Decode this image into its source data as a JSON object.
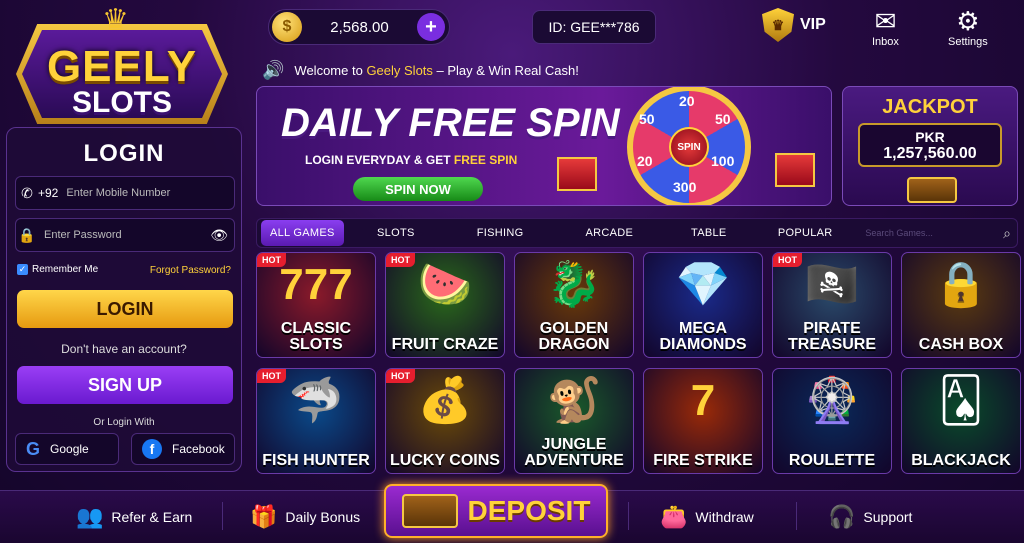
{
  "logo": {
    "line1": "GEELY",
    "line2": "SLOTS"
  },
  "topbar": {
    "balance": "2,568.00",
    "user_id": "ID: GEE***786",
    "vip_label": "VIP",
    "inbox_label": "Inbox",
    "settings_label": "Settings"
  },
  "marquee": {
    "prefix": "Welcome to ",
    "brand": "Geely Slots",
    "suffix": " – Play & Win Real Cash!"
  },
  "login": {
    "title": "LOGIN",
    "country_code": "+92",
    "mobile_placeholder": "Enter Mobile Number",
    "password_placeholder": "Enter Password",
    "remember_label": "Remember Me",
    "forgot_label": "Forgot Password?",
    "login_button": "LOGIN",
    "no_account": "Don't have an account?",
    "signup_button": "SIGN UP",
    "or_login_with": "Or Login With",
    "google_label": "Google",
    "facebook_label": "Facebook"
  },
  "banner": {
    "title": "DAILY FREE SPIN",
    "subtitle_prefix": "LOGIN EVERYDAY & GET ",
    "subtitle_highlight": "FREE SPIN",
    "button": "SPIN NOW",
    "wheel_center": "SPIN",
    "wheel_numbers": [
      "20",
      "50",
      "100",
      "300",
      "20",
      "50"
    ]
  },
  "jackpot": {
    "title": "JACKPOT",
    "currency": "PKR",
    "value": "1,257,560.00"
  },
  "tabs": [
    {
      "label": "ALL GAMES",
      "active": true
    },
    {
      "label": "SLOTS",
      "active": false
    },
    {
      "label": "FISHING",
      "active": false
    },
    {
      "label": "ARCADE",
      "active": false
    },
    {
      "label": "TABLE",
      "active": false
    },
    {
      "label": "POPULAR",
      "active": false
    }
  ],
  "search": {
    "placeholder": "Search Games..."
  },
  "games": [
    {
      "name": "CLASSIC SLOTS",
      "hot": true,
      "icon": "777",
      "bg": "#8a1a2a"
    },
    {
      "name": "FRUIT CRAZE",
      "hot": true,
      "icon": "🍉",
      "bg": "#2a6a1a"
    },
    {
      "name": "GOLDEN DRAGON",
      "hot": false,
      "icon": "🐉",
      "bg": "#6a3a08"
    },
    {
      "name": "MEGA DIAMONDS",
      "hot": false,
      "icon": "💎",
      "bg": "#1a2a8a"
    },
    {
      "name": "PIRATE TREASURE",
      "hot": true,
      "icon": "🏴‍☠️",
      "bg": "#2a4a6a"
    },
    {
      "name": "CASH BOX",
      "hot": false,
      "icon": "🔒",
      "bg": "#5a3a10"
    },
    {
      "name": "FISH HUNTER",
      "hot": true,
      "icon": "🦈",
      "bg": "#0a4a8a"
    },
    {
      "name": "LUCKY COINS",
      "hot": true,
      "icon": "💰",
      "bg": "#6a4a08"
    },
    {
      "name": "JUNGLE ADVENTURE",
      "hot": false,
      "icon": "🐒",
      "bg": "#1a5a2a"
    },
    {
      "name": "FIRE STRIKE",
      "hot": false,
      "icon": "7",
      "bg": "#9a2a08"
    },
    {
      "name": "ROULETTE",
      "hot": false,
      "icon": "🎡",
      "bg": "#0a2a5a"
    },
    {
      "name": "BLACKJACK",
      "hot": false,
      "icon": "🂡",
      "bg": "#0a4a2a"
    }
  ],
  "bottom": {
    "refer": "Refer & Earn",
    "daily_bonus": "Daily Bonus",
    "deposit": "DEPOSIT",
    "withdraw": "Withdraw",
    "support": "Support"
  },
  "colors": {
    "accent_gold": "#ffd23a",
    "accent_purple": "#8a3ef0",
    "hot_red": "#e61e2e"
  }
}
